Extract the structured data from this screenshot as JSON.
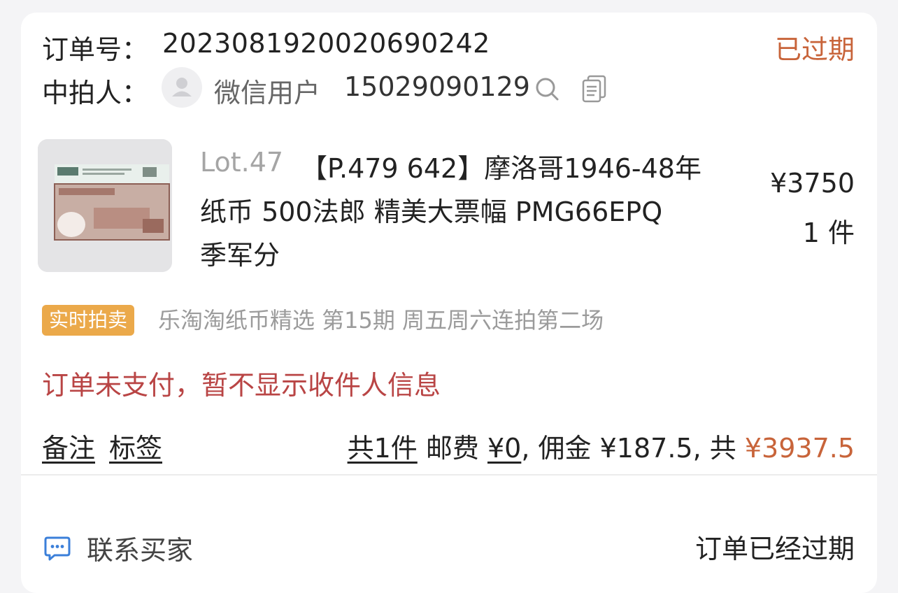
{
  "order": {
    "label": "订单号：",
    "number": "2023081920020690242",
    "status": "已过期"
  },
  "winner": {
    "label": "中拍人：",
    "name": "微信用户",
    "id": "15029090129"
  },
  "item": {
    "lot": "Lot.47",
    "title_line1": "【P.479 642】摩洛哥1946-48年",
    "title_line2": "纸币 500法郎 精美大票幅 PMG66EPQ",
    "title_line3": "季军分",
    "price": "¥3750",
    "quantity": "1 件"
  },
  "auction": {
    "badge": "实时拍卖",
    "session": "乐淘淘纸币精选 第15期 周五周六连拍第二场"
  },
  "notice": "订单未支付，暂不显示收件人信息",
  "actions": {
    "notes": "备注",
    "tags": "标签"
  },
  "summary": {
    "count": "共1件",
    "shipping_label": "邮费",
    "shipping_value": "¥0",
    "commission_label": ", 佣金",
    "commission_value": "¥187.5",
    "total_label": ", 共",
    "total_value": "¥3937.5"
  },
  "footer": {
    "contact_label": "联系买家",
    "status_text": "订单已经过期"
  },
  "colors": {
    "accent": "#c8643a",
    "notice": "#b94545",
    "badge": "#eba94a",
    "chat_icon": "#3b7fd9"
  },
  "icons": {
    "avatar": "user-avatar-placeholder",
    "search": "search-icon",
    "copy": "copy-icon",
    "chat": "chat-icon"
  }
}
